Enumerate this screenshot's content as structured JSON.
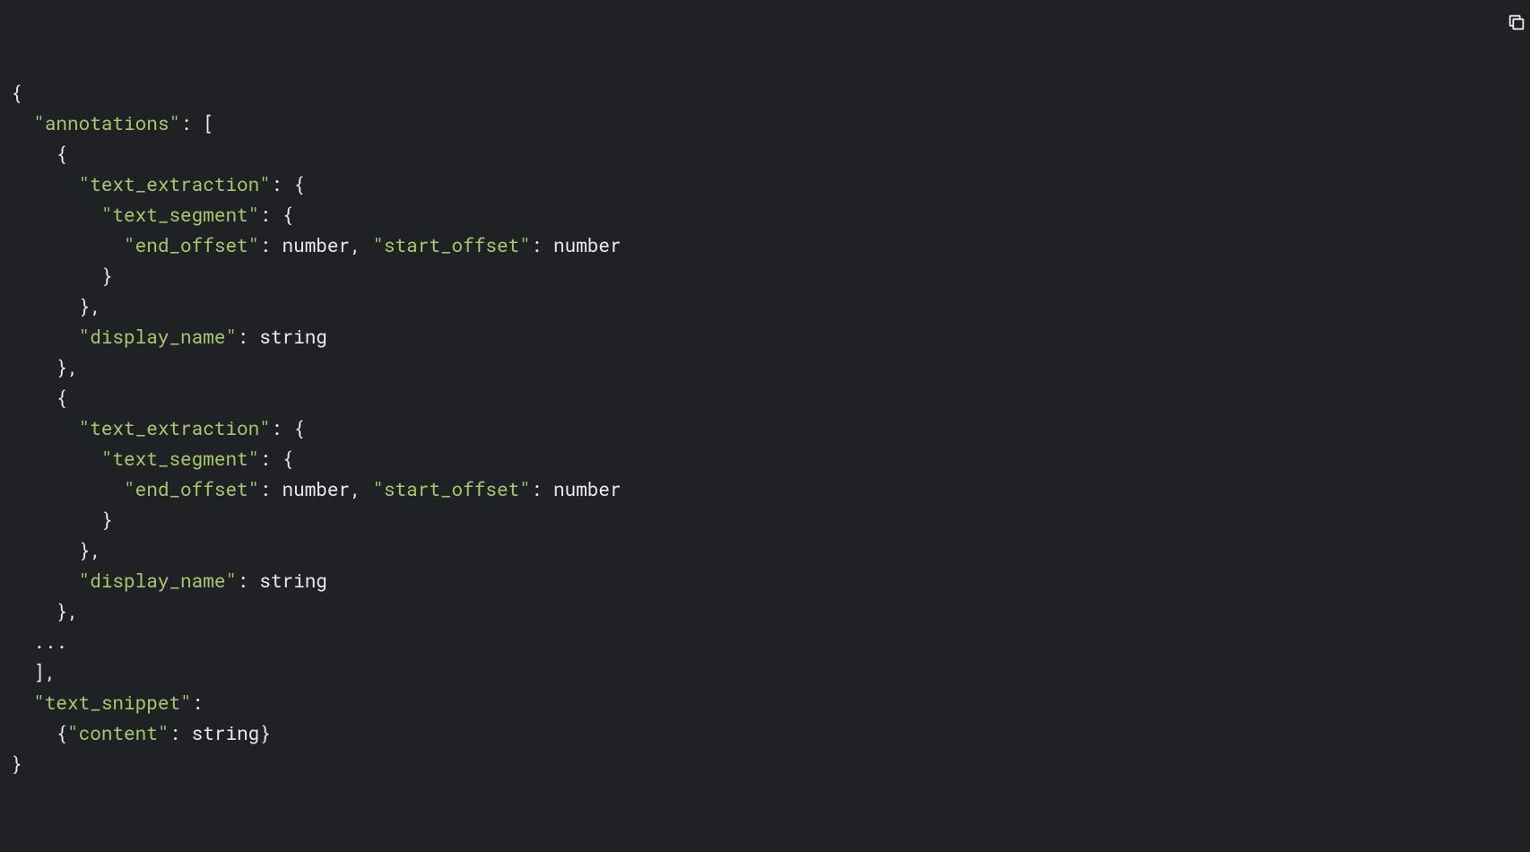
{
  "code": {
    "keys": {
      "annotations": "\"annotations\"",
      "text_extraction": "\"text_extraction\"",
      "text_segment": "\"text_segment\"",
      "end_offset": "\"end_offset\"",
      "start_offset": "\"start_offset\"",
      "display_name": "\"display_name\"",
      "text_snippet": "\"text_snippet\"",
      "content": "\"content\""
    },
    "types": {
      "number": "number",
      "string": "string"
    },
    "punct": {
      "open_brace": "{",
      "close_brace": "}",
      "open_bracket": "[",
      "close_bracket": "]",
      "colon": ":",
      "colon_sp": ": ",
      "comma": ",",
      "comma_sp": ", ",
      "close_brace_comma": "},",
      "close_bracket_comma": "],",
      "ellipsis": "..."
    }
  },
  "copy_label": "Copy"
}
